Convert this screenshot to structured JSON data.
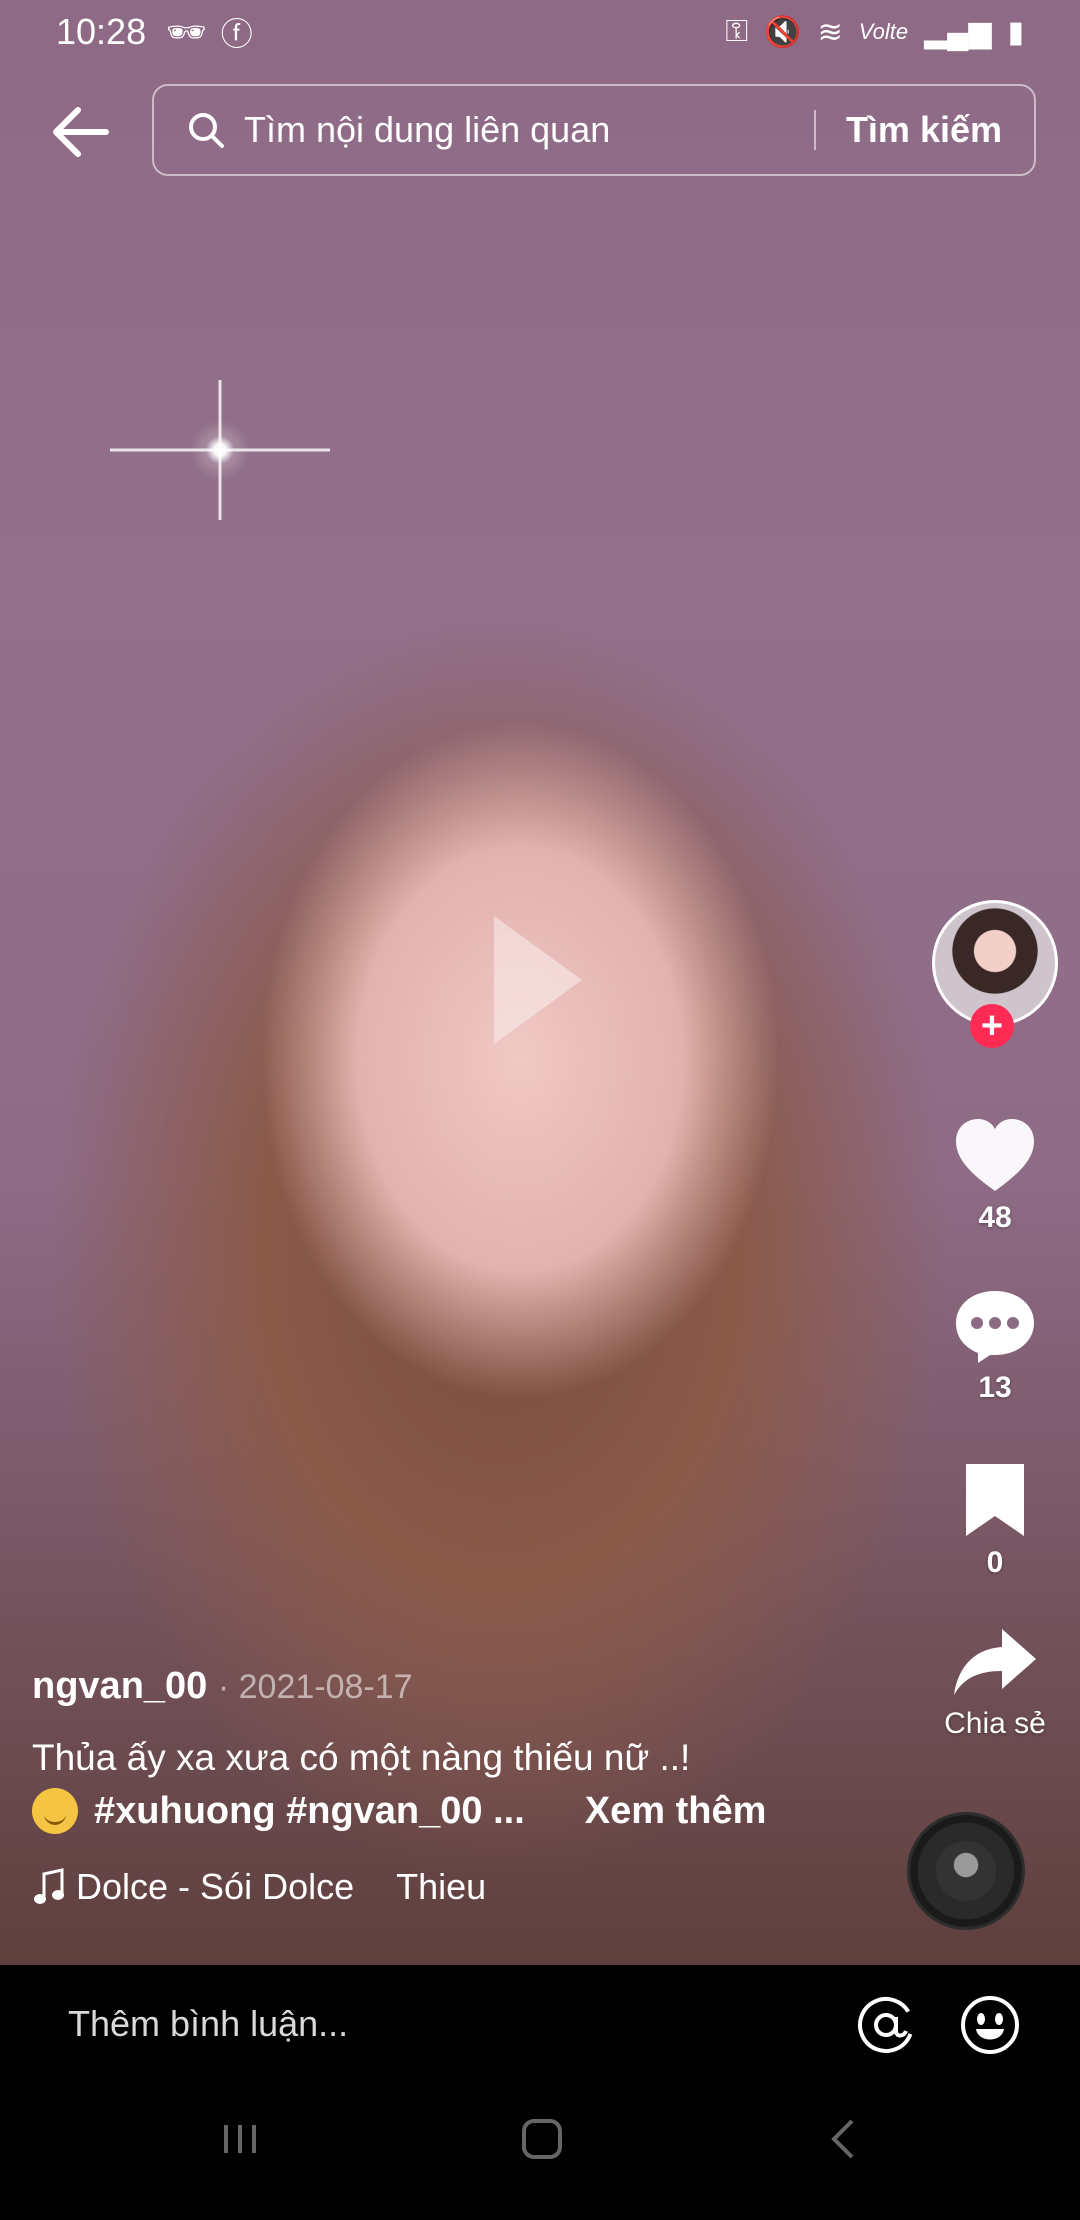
{
  "status_bar": {
    "time": "10:28",
    "network_label": "Volte"
  },
  "search": {
    "query": "Tìm nội dung liên quan",
    "button_label": "Tìm kiếm"
  },
  "actions": {
    "likes": "48",
    "comments": "13",
    "saves": "0",
    "share_label": "Chia sẻ"
  },
  "post": {
    "author": "ngvan_00",
    "date": "· 2021-08-17",
    "description": "Thủa ấy xa xưa có một nàng thiếu nữ ..!",
    "tags": "#xuhuong #ngvan_00 ...",
    "see_more": "Xem thêm",
    "music_title": "Dolce - Sói Dolce",
    "music_artist": "Thieu"
  },
  "comment_bar": {
    "placeholder": "Thêm bình luận..."
  },
  "colors": {
    "accent": "#fe2c55",
    "background": "#000000"
  }
}
